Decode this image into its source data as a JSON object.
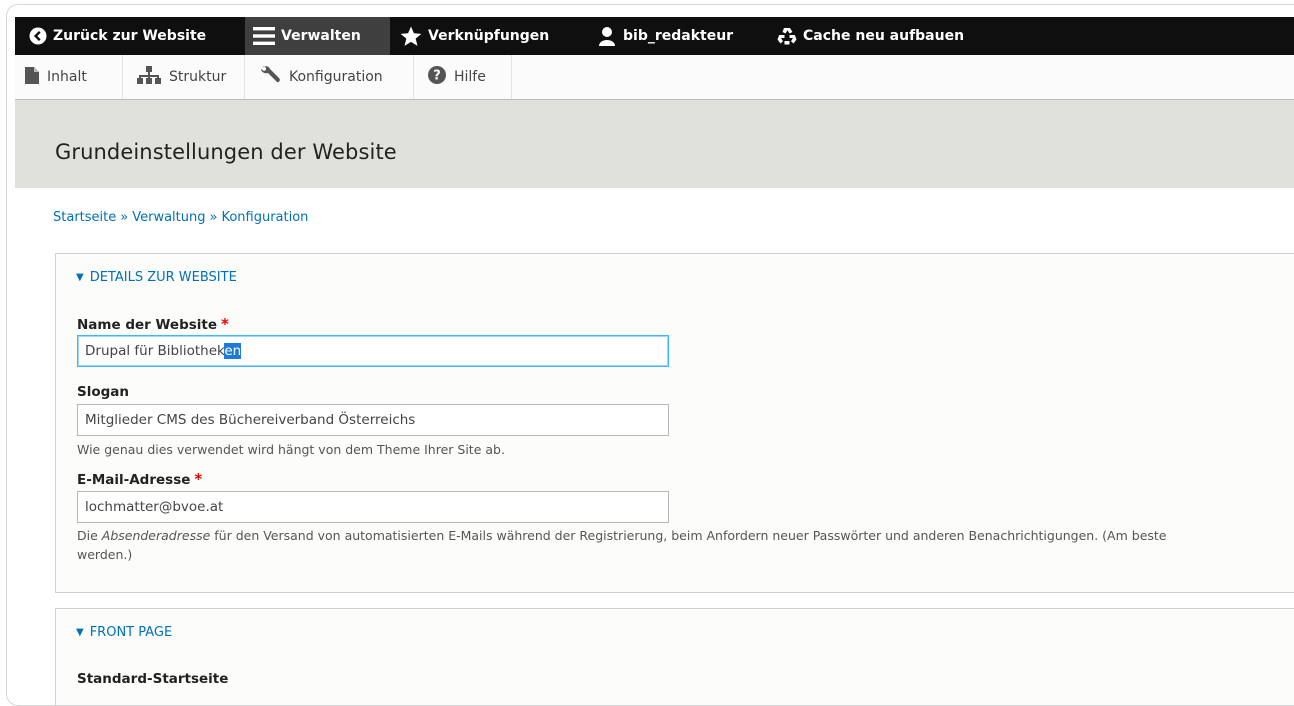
{
  "toolbar": {
    "back_label": "Zurück zur Website",
    "manage_label": "Verwalten",
    "shortcuts_label": "Verknüpfungen",
    "user_label": "bib_redakteur",
    "cache_label": "Cache neu aufbauen"
  },
  "tray": {
    "items": [
      {
        "label": "Inhalt",
        "icon": "file-icon"
      },
      {
        "label": "Struktur",
        "icon": "sitemap-icon"
      },
      {
        "label": "Konfiguration",
        "icon": "wrench-icon"
      },
      {
        "label": "Hilfe",
        "icon": "help-icon"
      }
    ]
  },
  "page": {
    "title": "Grundeinstellungen der Website"
  },
  "breadcrumb": {
    "items": [
      "Startseite",
      "Verwaltung",
      "Konfiguration"
    ],
    "separator": "»"
  },
  "site_details": {
    "summary": "Details zur Website",
    "name_label": "Name der Website",
    "required_marker": "*",
    "name_value_before": "Drupal für Bibliothek",
    "name_value_selected": "en",
    "slogan_label": "Slogan",
    "slogan_value": "Mitglieder CMS des Büchereiverband Österreichs",
    "slogan_desc": "Wie genau dies verwendet wird hängt von dem Theme Ihrer Site ab.",
    "email_label": "E-Mail-Adresse",
    "email_value": "lochmatter@bvoe.at",
    "email_desc_pre": "Die ",
    "email_desc_em": "Absenderadresse",
    "email_desc_post": " für den Versand von automatisierten E-Mails während der Registrierung, beim Anfordern neuer Passwörter und anderen Benachrichtigungen. (Am beste",
    "email_desc_line2": "werden.)"
  },
  "front_page": {
    "summary": "Front page",
    "default_label": "Standard-Startseite"
  },
  "colors": {
    "toolbar_bg": "#0f0f0f",
    "active_tab": "#3f3f3f",
    "link": "#0071b8",
    "header_bg": "#e1e1dc",
    "required": "#e00000",
    "focus": "#40b6ff"
  }
}
